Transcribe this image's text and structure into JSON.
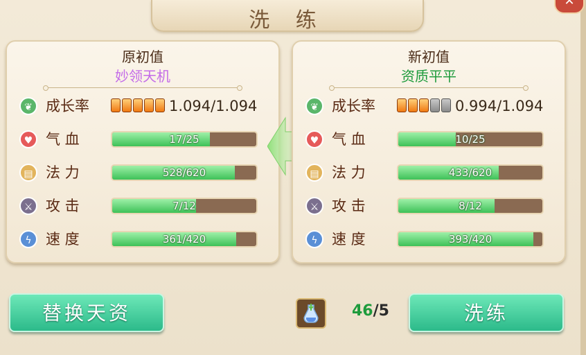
{
  "title": "洗 练",
  "close_symbol": "✕",
  "left_panel": {
    "heading": "原初值",
    "quality": "妙领天机",
    "growth": {
      "label": "成长率",
      "stars_on": 5,
      "stars_total": 5,
      "value": "1.094/1.094"
    },
    "stats": [
      {
        "label": "气 血",
        "text": "17/25",
        "fraction": 0.68,
        "icon": "heart-icon"
      },
      {
        "label": "法 力",
        "text": "528/620",
        "fraction": 0.8516,
        "icon": "scroll-icon"
      },
      {
        "label": "攻 击",
        "text": "7/12",
        "fraction": 0.5833,
        "icon": "sword-icon"
      },
      {
        "label": "速 度",
        "text": "361/420",
        "fraction": 0.8595,
        "icon": "lightning-icon"
      }
    ]
  },
  "right_panel": {
    "heading": "新初值",
    "quality": "资质平平",
    "growth": {
      "label": "成长率",
      "stars_on": 3,
      "stars_total": 5,
      "value": "0.994/1.094"
    },
    "stats": [
      {
        "label": "气 血",
        "text": "10/25",
        "fraction": 0.4,
        "icon": "heart-icon"
      },
      {
        "label": "法 力",
        "text": "433/620",
        "fraction": 0.6984,
        "icon": "scroll-icon"
      },
      {
        "label": "攻 击",
        "text": "8/12",
        "fraction": 0.6667,
        "icon": "sword-icon"
      },
      {
        "label": "速 度",
        "text": "393/420",
        "fraction": 0.9357,
        "icon": "lightning-icon"
      }
    ]
  },
  "buttons": {
    "replace": "替换天资",
    "refine": "洗练"
  },
  "item": {
    "icon": "potion-bottle-icon",
    "have": "46",
    "separator": "/",
    "need": "5"
  },
  "colors": {
    "accent_green": "#3ec158",
    "quality_purple": "#c46ce8",
    "quality_green": "#1e9b3c",
    "button_teal": "#2cba8a"
  }
}
